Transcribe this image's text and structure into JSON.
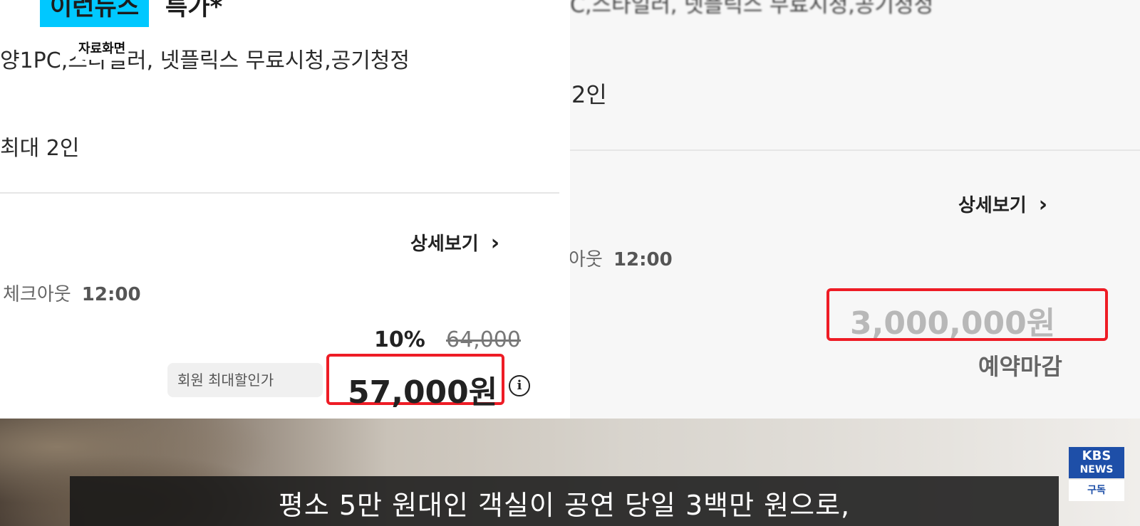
{
  "left": {
    "title_highlight": "이런뉴스",
    "title_rest": "특가*",
    "amenities": "양1PC,스타일러, 넷플릭스 무료시청,공기청정",
    "caption_tag": "자료화면",
    "capacity": "최대 2인",
    "detail_link": "상세보기",
    "checkout_label": "체크아웃",
    "checkout_time": "12:00",
    "discount_rate": "10%",
    "original_price": "64,000",
    "member_badge": "회원 최대할인가",
    "price": "57,000원",
    "info_icon": "i"
  },
  "right": {
    "amenities": "C,스타일러, 넷플릭스 무료시청,공기청정",
    "capacity": "2인",
    "detail_link": "상세보기",
    "checkout_label": "아웃",
    "checkout_time": "12:00",
    "price": "3,000,000원",
    "status": "예약마감"
  },
  "video": {
    "subtitle": "평소 5만 원대인 객실이 공연 당일 3백만 원으로,",
    "logo_line1": "KBS",
    "logo_line2": "NEWS",
    "subscribe": "구독"
  },
  "colors": {
    "highlight": "#00c8ff",
    "price_box": "#ee1c25",
    "logo_blue": "#1e4fa8"
  },
  "icons": [
    "chevron-right-icon",
    "info-icon",
    "kbs-news-logo"
  ]
}
